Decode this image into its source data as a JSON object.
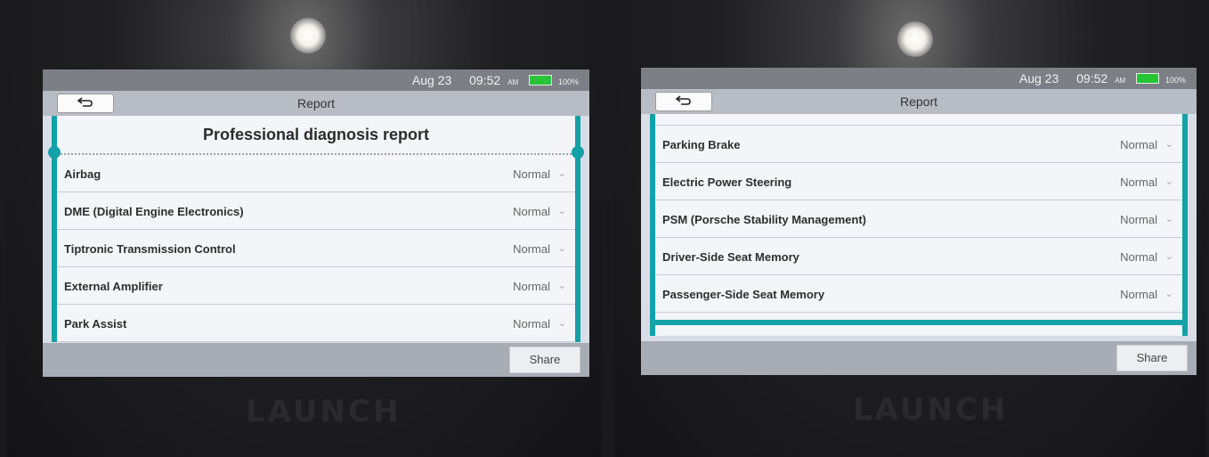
{
  "status_bar": {
    "date": "Aug 23",
    "time": "09:52",
    "ampm": "AM",
    "battery": "100%"
  },
  "titlebar": {
    "title": "Report"
  },
  "brand": "LAUNCH",
  "left": {
    "heading": "Professional diagnosis report",
    "rows": [
      {
        "name": "Airbag",
        "status": "Normal"
      },
      {
        "name": "DME (Digital Engine Electronics)",
        "status": "Normal"
      },
      {
        "name": "Tiptronic Transmission Control",
        "status": "Normal"
      },
      {
        "name": "External Amplifier",
        "status": "Normal"
      },
      {
        "name": "Park Assist",
        "status": "Normal"
      }
    ]
  },
  "right": {
    "rows": [
      {
        "name": "Parking Brake",
        "status": "Normal"
      },
      {
        "name": "Electric Power Steering",
        "status": "Normal"
      },
      {
        "name": "PSM (Porsche Stability Management)",
        "status": "Normal"
      },
      {
        "name": "Driver-Side Seat Memory",
        "status": "Normal"
      },
      {
        "name": "Passenger-Side Seat Memory",
        "status": "Normal"
      }
    ]
  },
  "share_label": "Share",
  "icons": {
    "back": "back-arrow-icon",
    "battery": "battery-icon",
    "chevron": "chevron-down-icon"
  },
  "colors": {
    "accent": "#13a2a8",
    "battery": "#26c437"
  }
}
